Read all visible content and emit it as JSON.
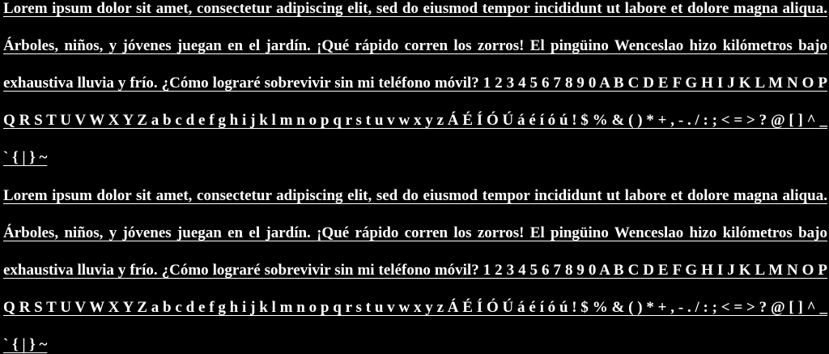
{
  "document": {
    "paragraphs": [
      {
        "lead": "Lorem ipsum dolor sit amet, consectetur adipiscing elit, sed do eiusmod tempor incididunt ut labore et dolore magna aliqua. Árboles, niños, y jóvenes juegan en el jardín. ¡Qué rápido corren los zorros! El pingüino Wenceslao hizo kilómetros bajo exhaustiva lluvia y frío. ¿Cómo lograré sobrevivir sin mi teléfono móvil? 1 2 3 4 5 6 7 8 9 0 A B C D E F G H I J K L M N O P Q R S T U V W X Y Z a b c d e f g h i j k l m n o p q r s t u v w x y z Á É Í Ó Ú á é í ó ú ! $ % & ( ) * + , - . / : ; < = > ? @ [ ] ^ _ ` { | } ~"
      },
      {
        "lead": "Lorem ipsum dolor sit amet, consectetur adipiscing elit, sed do eiusmod tempor incididunt ut labore et dolore magna aliqua. Árboles, niños, y jóvenes juegan en el jardín. ¡Qué rápido corren los zorros! El pingüino Wenceslao hizo kilómetros bajo exhaustiva lluvia y frío. ¿Cómo lograré sobrevivir sin mi teléfono móvil? 1 2 3 4 5 6 7 8 9 0 A B C D E F G H I J K L M N O P Q R S T U V W X Y Z a b c d e f g h i j k l m n o p q r s t u v w x y z Á É Í Ó Ú á é í ó ú ! $ % & ( ) * + , - . / : ; < = > ? @ [ ] ^ _ ` { | } ~"
      }
    ]
  },
  "colors": {
    "background": "#000000",
    "text": "#ffffff"
  }
}
